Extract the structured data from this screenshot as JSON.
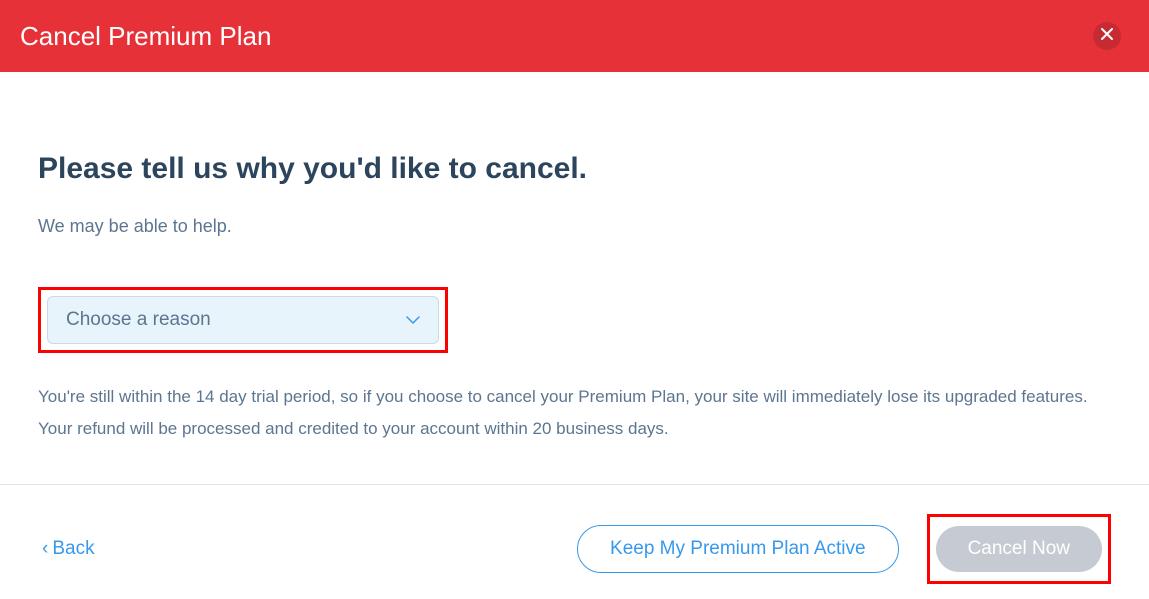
{
  "header": {
    "title": "Cancel Premium Plan"
  },
  "main": {
    "heading": "Please tell us why you'd like to cancel.",
    "subtext": "We may be able to help.",
    "reason_select": {
      "placeholder": "Choose a reason"
    },
    "info": "You're still within the 14 day trial period, so if you choose to cancel your Premium Plan, your site will immediately lose its upgraded features. Your refund will be processed and credited to your account within 20 business days."
  },
  "footer": {
    "back_label": "Back",
    "keep_label": "Keep My Premium Plan Active",
    "cancel_label": "Cancel Now"
  }
}
